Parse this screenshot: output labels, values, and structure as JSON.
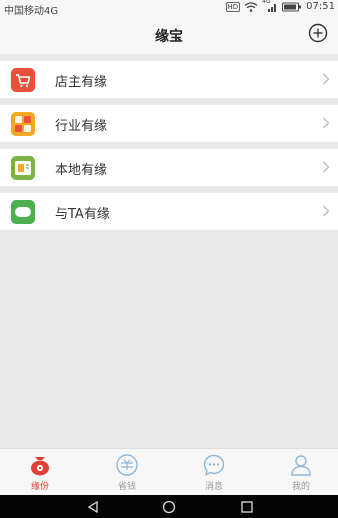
{
  "status_bar": {
    "carrier": "中国移动4G",
    "hd_badge": "HD",
    "signal_label": "4G",
    "time": "07:51"
  },
  "header": {
    "title": "缘宝",
    "add_icon": "plus-circle-icon"
  },
  "menu": [
    {
      "label": "店主有缘",
      "icon": "shopping-cart-icon",
      "color": "#e8503a"
    },
    {
      "label": "行业有缘",
      "icon": "grid-icon",
      "color": "#f5a623"
    },
    {
      "label": "本地有缘",
      "icon": "local-card-icon",
      "color": "#7cb342"
    },
    {
      "label": "与TA有缘",
      "icon": "chat-bubble-icon",
      "color": "#4caf50"
    }
  ],
  "tabs": [
    {
      "label": "缘份",
      "icon": "pouch-icon",
      "active": true
    },
    {
      "label": "省钱",
      "icon": "coupon-icon",
      "active": false
    },
    {
      "label": "消息",
      "icon": "message-icon",
      "active": false
    },
    {
      "label": "我的",
      "icon": "person-icon",
      "active": false
    }
  ],
  "colors": {
    "accent": "#e0403a",
    "inactive": "#8fb8d8"
  }
}
